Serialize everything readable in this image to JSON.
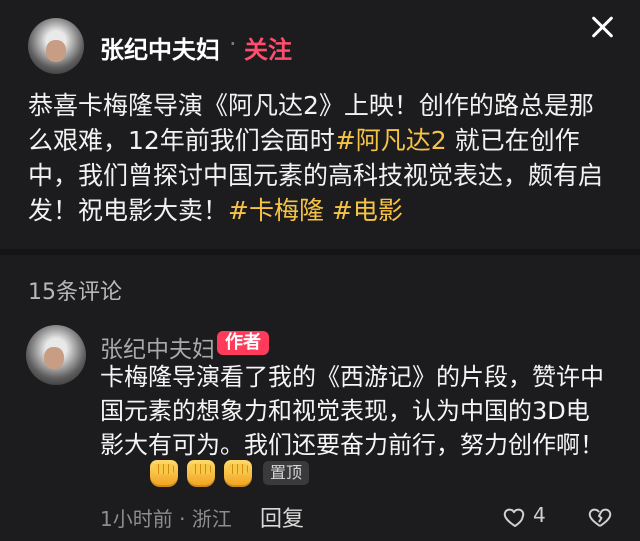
{
  "post": {
    "author": "张纪中夫妇",
    "separator": "·",
    "follow_label": "关注",
    "text_before": "恭喜卡梅隆导演《阿凡达2》上映！创作的路总是那么艰难，12年前我们会面时",
    "hashtag_1": "#阿凡达2",
    "text_middle": " 就已在创作中，我们曾探讨中国元素的高科技视觉表达，颇有启发！祝电影大卖！",
    "hashtag_2": "#卡梅隆",
    "hashtag_3": "#电影"
  },
  "comments_section": {
    "count_label": "15条评论"
  },
  "comment": {
    "author": "张纪中夫妇",
    "author_badge": "作者",
    "text": "卡梅隆导演看了我的《西游记》的片段，赞许中国元素的想象力和视觉表现，认为中国的3D电影大有可为。我们还要奋力前行，努力创作啊！",
    "pin_badge": "置顶",
    "meta": "1小时前 · 浙江",
    "reply_label": "回复",
    "like_count": "4"
  },
  "icons": {
    "close": "close-icon",
    "like": "heart-icon",
    "dislike": "broken-heart-icon",
    "emoji": "clenched-fist-emoji"
  },
  "colors": {
    "background": "#1c1c1e",
    "hashtag": "#f6c344",
    "follow": "#ff4d6d",
    "author_badge": "#ff3b5c"
  }
}
